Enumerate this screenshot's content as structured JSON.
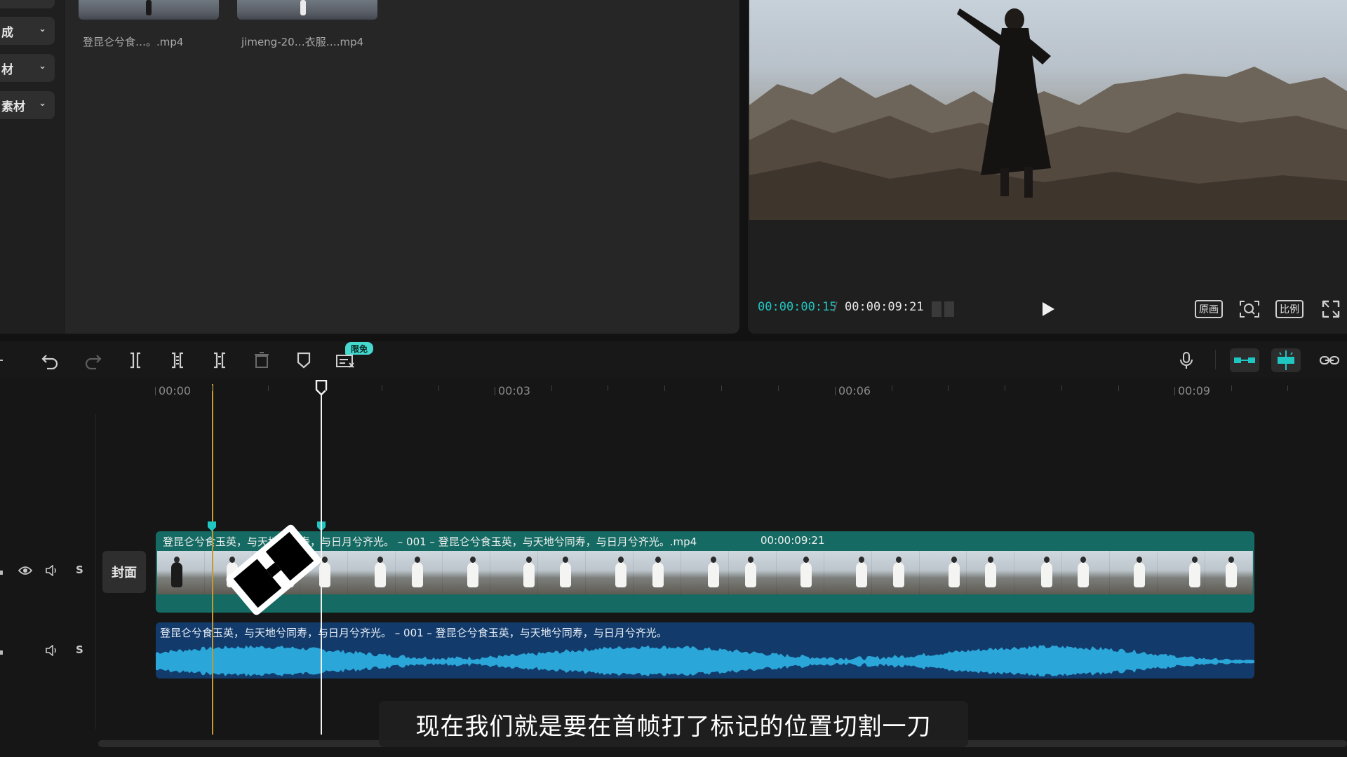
{
  "media_panel": {
    "sidebar_items": [
      {
        "label": "成"
      },
      {
        "label": "材"
      },
      {
        "label": "素材"
      }
    ],
    "thumbnails": [
      {
        "label": "登昆仑兮食…。.mp4"
      },
      {
        "label": "jimeng-20…衣服….mp4"
      }
    ]
  },
  "preview": {
    "time_current": "00:00:00:15",
    "time_separator": "/",
    "time_total": "00:00:09:21",
    "buttons": {
      "original": "原画",
      "ratio": "比例"
    }
  },
  "toolbar": {
    "badge_free": "限免",
    "icons": [
      "undo-icon",
      "redo-icon",
      "split-icon",
      "split-left-icon",
      "split-right-icon",
      "delete-icon",
      "marker-icon",
      "auto-caption-icon",
      "microphone-icon",
      "link-icon"
    ],
    "accent_color": "#20c6c2"
  },
  "timeline": {
    "ruler": [
      "00:00",
      "00:03",
      "00:06",
      "00:09"
    ],
    "cover_label": "封面",
    "track_ctrls": {
      "solo": "S"
    },
    "video_clip": {
      "title": "登昆仑兮食玉英，与天地兮同寿，与日月兮齐光。 – 001 – 登昆仑兮食玉英，与天地兮同寿，与日月兮齐光。.mp4",
      "duration": "00:00:09:21",
      "color": "#156b63"
    },
    "audio_clip": {
      "title": "登昆仑兮食玉英，与天地兮同寿，与日月兮齐光。 – 001 – 登昆仑兮食玉英，与天地兮同寿，与日月兮齐光。",
      "color": "#123b6b",
      "wave_color": "#2aa6d9"
    }
  },
  "subtitle": "现在我们就是要在首帧打了标记的位置切割一刀"
}
